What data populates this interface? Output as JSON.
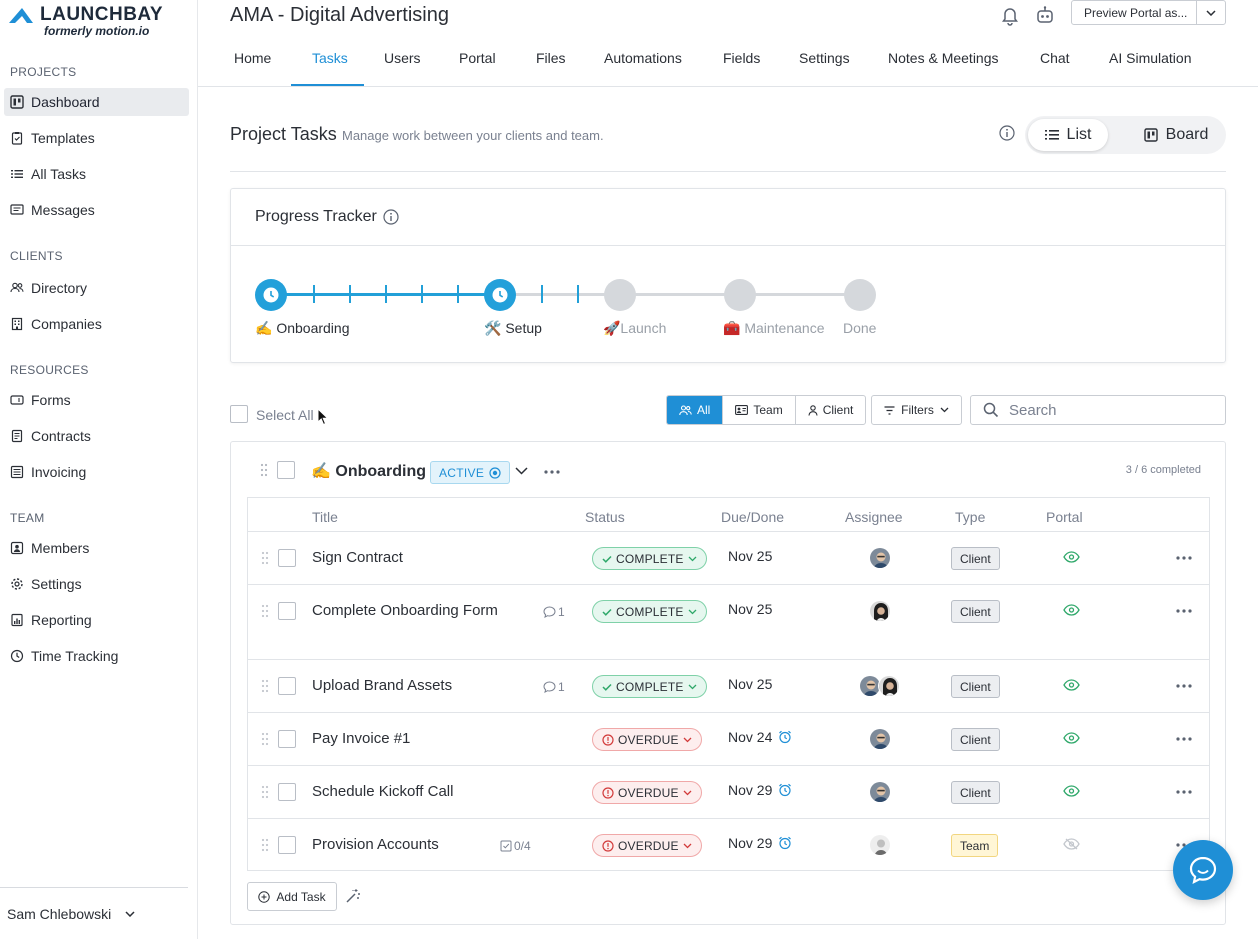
{
  "brand": {
    "name": "LAUNCHBAY",
    "subtitle": "formerly motion.io"
  },
  "sidebar": {
    "sections": [
      {
        "title": "PROJECTS",
        "items": [
          {
            "label": "Dashboard",
            "icon": "dashboard-icon",
            "active": true
          },
          {
            "label": "Templates",
            "icon": "template-icon"
          },
          {
            "label": "All Tasks",
            "icon": "list-icon"
          },
          {
            "label": "Messages",
            "icon": "messages-icon"
          }
        ]
      },
      {
        "title": "CLIENTS",
        "items": [
          {
            "label": "Directory",
            "icon": "users-icon"
          },
          {
            "label": "Companies",
            "icon": "building-icon"
          }
        ]
      },
      {
        "title": "RESOURCES",
        "items": [
          {
            "label": "Forms",
            "icon": "form-icon"
          },
          {
            "label": "Contracts",
            "icon": "contract-icon"
          },
          {
            "label": "Invoicing",
            "icon": "invoice-icon"
          }
        ]
      },
      {
        "title": "TEAM",
        "items": [
          {
            "label": "Members",
            "icon": "member-icon"
          },
          {
            "label": "Settings",
            "icon": "gear-icon"
          },
          {
            "label": "Reporting",
            "icon": "chart-icon"
          },
          {
            "label": "Time Tracking",
            "icon": "clock-icon"
          }
        ]
      }
    ],
    "user": "Sam Chlebowski"
  },
  "header": {
    "project_title": "AMA - Digital Advertising",
    "preview_label": "Preview Portal as...",
    "tabs": [
      "Home",
      "Tasks",
      "Users",
      "Portal",
      "Files",
      "Automations",
      "Fields",
      "Settings",
      "Notes & Meetings",
      "Chat",
      "AI Simulation"
    ],
    "active_tab": "Tasks"
  },
  "tasks_header": {
    "title": "Project Tasks",
    "subtitle": "Manage work between your clients and team.",
    "view_list": "List",
    "view_board": "Board"
  },
  "tracker": {
    "title": "Progress Tracker",
    "milestones": [
      {
        "label": "✍️ Onboarding",
        "state": "active"
      },
      {
        "label": "🛠️ Setup",
        "state": "active"
      },
      {
        "label": "🚀Launch",
        "state": "pending"
      },
      {
        "label": "🧰 Maintenance",
        "state": "pending"
      },
      {
        "label": "Done",
        "state": "pending"
      }
    ]
  },
  "toolbar": {
    "select_all": "Select All",
    "filter_all": "All",
    "filter_team": "Team",
    "filter_client": "Client",
    "filters_label": "Filters",
    "search_placeholder": "Search"
  },
  "group": {
    "title": "✍️ Onboarding",
    "status": "ACTIVE",
    "completed": "3 / 6 completed",
    "columns": [
      "Title",
      "Status",
      "Due/Done",
      "Assignee",
      "Type",
      "Portal"
    ],
    "rows": [
      {
        "title": "Sign Contract",
        "status": "COMPLETE",
        "due": "Nov 25",
        "type": "Client",
        "portal_visible": true
      },
      {
        "title": "Complete Onboarding Form",
        "comments": "1",
        "status": "COMPLETE",
        "due": "Nov 25",
        "type": "Client",
        "portal_visible": true
      },
      {
        "title": "Upload Brand Assets",
        "comments": "1",
        "status": "COMPLETE",
        "due": "Nov 25",
        "type": "Client",
        "portal_visible": true
      },
      {
        "title": "Pay Invoice #1",
        "status": "OVERDUE",
        "due": "Nov 24",
        "type": "Client",
        "portal_visible": true
      },
      {
        "title": "Schedule Kickoff Call",
        "status": "OVERDUE",
        "due": "Nov 29",
        "type": "Client",
        "portal_visible": true
      },
      {
        "title": "Provision Accounts",
        "checklist": "0/4",
        "status": "OVERDUE",
        "due": "Nov 29",
        "type": "Team",
        "portal_visible": false
      }
    ],
    "add_task": "Add Task"
  },
  "colors": {
    "accent": "#1f8fd6",
    "tracker": "#23a0da",
    "complete": "#2fa86a",
    "overdue": "#d23b3b"
  }
}
